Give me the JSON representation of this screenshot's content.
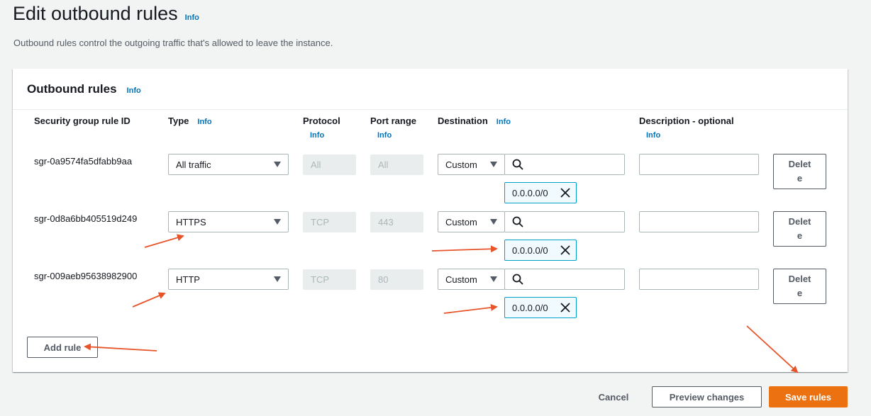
{
  "page": {
    "title": "Edit outbound rules",
    "title_info": "Info",
    "description": "Outbound rules control the outgoing traffic that's allowed to leave the instance."
  },
  "panel": {
    "title": "Outbound rules",
    "title_info": "Info",
    "columns": {
      "rule_id": "Security group rule ID",
      "type": "Type",
      "type_info": "Info",
      "protocol": "Protocol",
      "protocol_info": "Info",
      "port_range": "Port range",
      "port_range_info": "Info",
      "destination": "Destination",
      "destination_info": "Info",
      "description": "Description - optional",
      "description_info": "Info"
    },
    "rules": [
      {
        "id": "sgr-0a9574fa5dfabb9aa",
        "type": "All traffic",
        "protocol": "All",
        "port_range": "All",
        "destination_mode": "Custom",
        "destination_search": "",
        "cidr": "0.0.0.0/0",
        "description": "",
        "delete_label": "Delete"
      },
      {
        "id": "sgr-0d8a6bb405519d249",
        "type": "HTTPS",
        "protocol": "TCP",
        "port_range": "443",
        "destination_mode": "Custom",
        "destination_search": "",
        "cidr": "0.0.0.0/0",
        "description": "",
        "delete_label": "Delete"
      },
      {
        "id": "sgr-009aeb95638982900",
        "type": "HTTP",
        "protocol": "TCP",
        "port_range": "80",
        "destination_mode": "Custom",
        "destination_search": "",
        "cidr": "0.0.0.0/0",
        "description": "",
        "delete_label": "Delete"
      }
    ],
    "add_rule_label": "Add rule"
  },
  "footer": {
    "cancel_label": "Cancel",
    "preview_label": "Preview changes",
    "save_label": "Save rules"
  },
  "colors": {
    "accent_orange": "#ec7211",
    "annotation_arrow": "#e8542a",
    "link_blue": "#0073bb"
  }
}
